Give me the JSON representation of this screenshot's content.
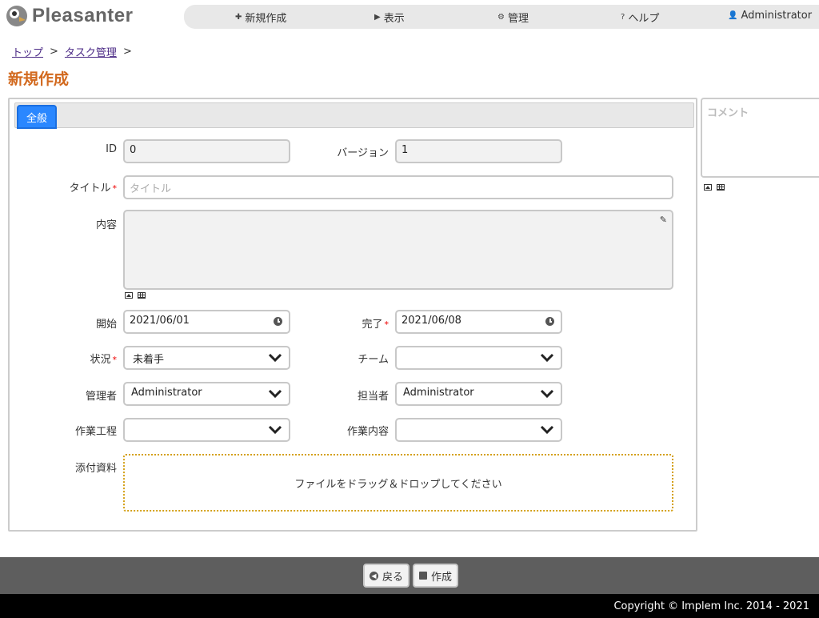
{
  "app": {
    "logo_text": "Pleasanter"
  },
  "nav": {
    "new": "新規作成",
    "view": "表示",
    "manage": "管理",
    "help": "ヘルプ",
    "user": "Administrator"
  },
  "breadcrumb": {
    "top": "トップ",
    "task": "タスク管理",
    "sep": ">"
  },
  "page_title": "新規作成",
  "tabs": [
    {
      "label": "全般"
    }
  ],
  "form": {
    "id_label": "ID",
    "id_value": "0",
    "version_label": "バージョン",
    "version_value": "1",
    "title_label": "タイトル",
    "title_placeholder": "タイトル",
    "body_label": "内容",
    "start_label": "開始",
    "start_value": "2021/06/01",
    "complete_label": "完了",
    "complete_value": "2021/06/08",
    "status_label": "状況",
    "status_value": "未着手",
    "team_label": "チーム",
    "team_value": "",
    "manager_label": "管理者",
    "manager_value": "Administrator",
    "owner_label": "担当者",
    "owner_value": "Administrator",
    "process_label": "作業工程",
    "process_value": "",
    "work_label": "作業内容",
    "work_value": "",
    "attach_label": "添付資料",
    "dropzone_text": "ファイルをドラッグ＆ドロップしてください",
    "required_mark": "*"
  },
  "comment": {
    "placeholder": "コメント"
  },
  "actions": {
    "back": "戻る",
    "create": "作成"
  },
  "footer": {
    "copyright": "Copyright © Implem Inc. 2014 - 2021"
  },
  "colors": {
    "accent": "#2a87ff",
    "title": "#d2691e",
    "actionbar": "#5e5e5e"
  }
}
